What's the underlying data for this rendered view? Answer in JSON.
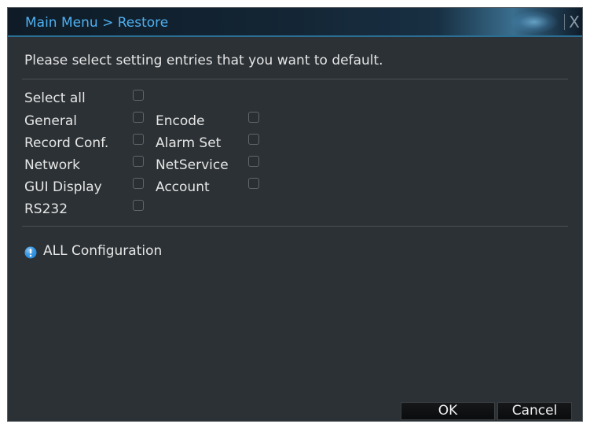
{
  "window": {
    "title": "Main Menu > Restore",
    "close_glyph": "X"
  },
  "prompt": "Please select setting entries that you want to default.",
  "options": {
    "select_all": "Select all",
    "general": "General",
    "encode": "Encode",
    "record_conf": "Record Conf.",
    "alarm_set": "Alarm Set",
    "network": "Network",
    "netservice": "NetService",
    "gui_display": "GUI Display",
    "account": "Account",
    "rs232": "RS232"
  },
  "info": {
    "text": "ALL Configuration",
    "icon": "info-icon"
  },
  "buttons": {
    "ok": "OK",
    "cancel": "Cancel"
  },
  "colors": {
    "title_text": "#4fb0f0",
    "panel_bg": "#2c3135",
    "info_icon": "#2a8fe0"
  }
}
